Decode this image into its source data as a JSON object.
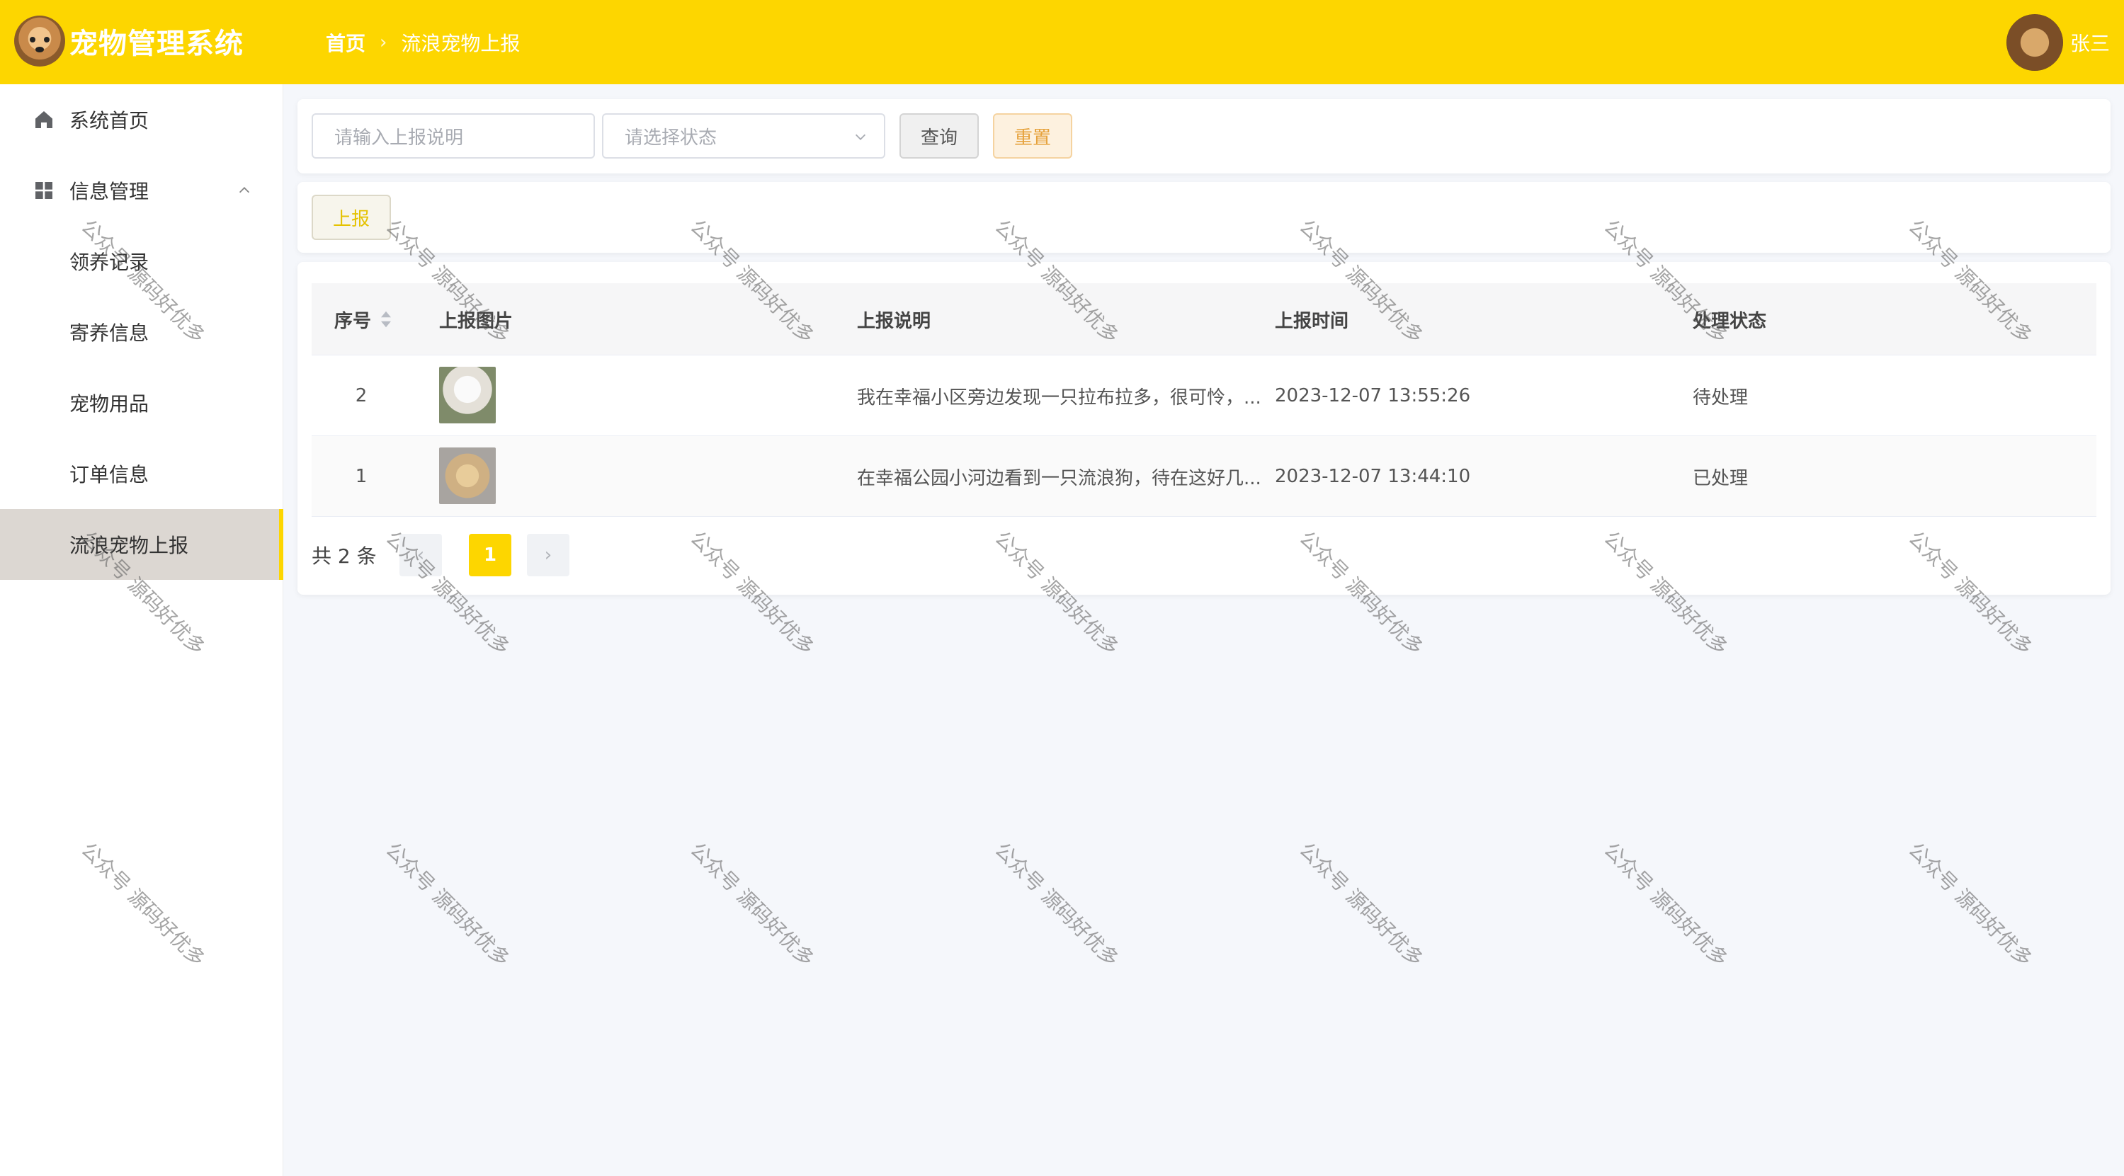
{
  "app": {
    "title": "宠物管理系统"
  },
  "breadcrumb": {
    "home": "首页",
    "current": "流浪宠物上报"
  },
  "user": {
    "name": "张三"
  },
  "sidebar": {
    "home": "系统首页",
    "group": "信息管理",
    "items": [
      "领养记录",
      "寄养信息",
      "宠物用品",
      "订单信息",
      "流浪宠物上报"
    ],
    "active_index": 4
  },
  "search": {
    "desc_placeholder": "请输入上报说明",
    "status_placeholder": "请选择状态",
    "query_label": "查询",
    "reset_label": "重置"
  },
  "actions": {
    "report_label": "上报"
  },
  "table": {
    "headers": [
      "序号",
      "上报图片",
      "上报说明",
      "上报时间",
      "处理状态"
    ],
    "rows": [
      {
        "id": "2",
        "desc": "我在幸福小区旁边发现一只拉布拉多，很可怜，...",
        "time": "2023-12-07 13:55:26",
        "status": "待处理"
      },
      {
        "id": "1",
        "desc": "在幸福公园小河边看到一只流浪狗，待在这好几...",
        "time": "2023-12-07 13:44:10",
        "status": "已处理"
      }
    ]
  },
  "pagination": {
    "total_text": "共 2 条",
    "current_page": "1"
  },
  "watermark": {
    "text": "公众号 源码好优多"
  },
  "colors": {
    "accent": "#fdd600",
    "active_bg": "#dcd7d2"
  }
}
